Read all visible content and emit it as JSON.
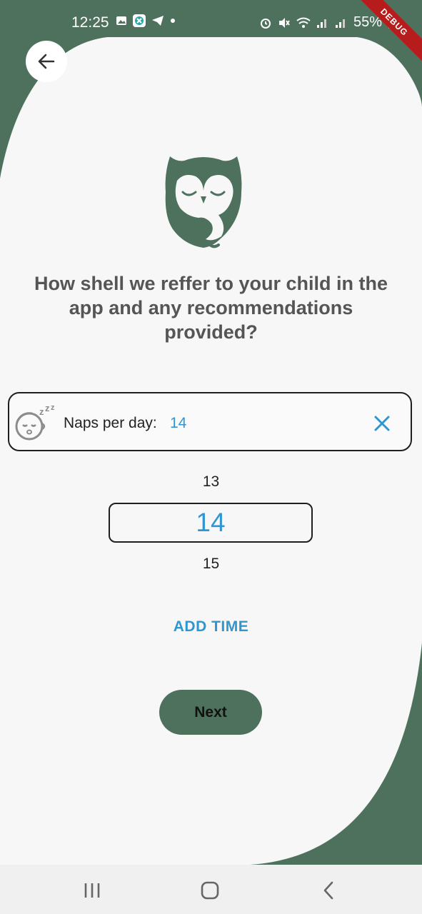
{
  "status_bar": {
    "time": "12:25",
    "battery": "55%",
    "debug_label": "DEBUG",
    "icons": [
      "gallery-icon",
      "app-icon",
      "telegram-icon",
      "dot-icon",
      "alarm-icon",
      "mute-icon",
      "wifi-icon",
      "signal-icon",
      "signal-icon",
      "battery-icon"
    ]
  },
  "header": {
    "back_icon": "arrow-left-icon"
  },
  "logo": {
    "icon": "owl-logo"
  },
  "question": "How shell we reffer to your child in  the app and any recommendations provided?",
  "field": {
    "icon": "sleeping-baby-icon",
    "label": "Naps per day:",
    "value": "14",
    "clear_icon": "close-icon"
  },
  "picker": {
    "prev": "13",
    "selected": "14",
    "next": "15"
  },
  "add_time": "ADD TIME",
  "next_button": "Next",
  "nav_bar": {
    "icons": [
      "recents-icon",
      "home-icon",
      "back-icon"
    ]
  },
  "colors": {
    "green": "#4e715e",
    "accent": "#2f96d2",
    "background": "#f7f7f7"
  }
}
